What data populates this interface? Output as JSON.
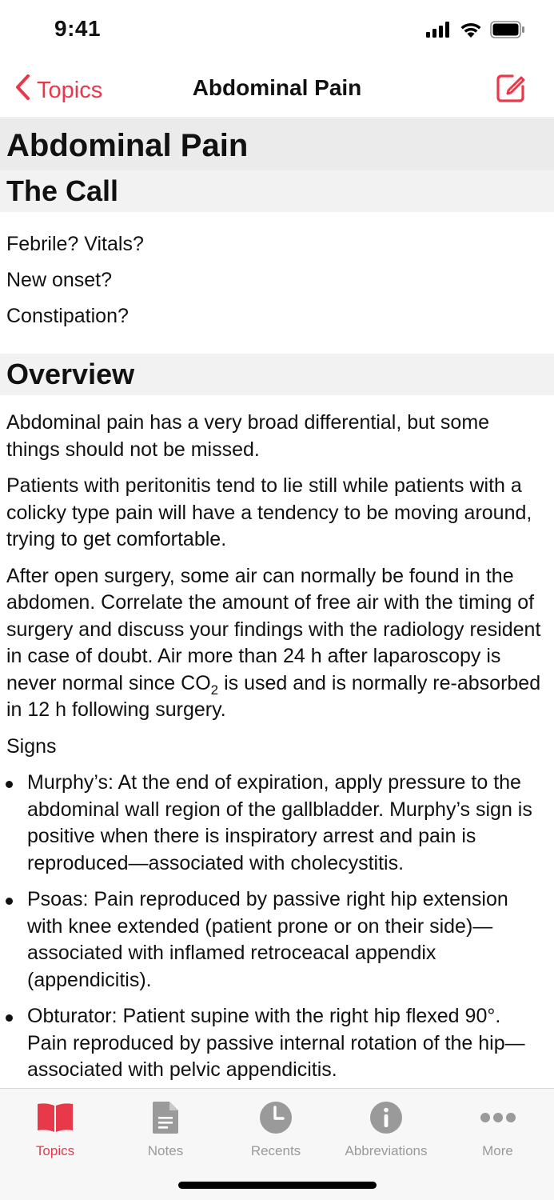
{
  "status_bar": {
    "time": "9:41"
  },
  "nav": {
    "back_label": "Topics",
    "title": "Abdominal Pain"
  },
  "page_title": "Abdominal Pain",
  "the_call": {
    "heading": "The Call",
    "items": [
      "Febrile? Vitals?",
      "New onset?",
      "Constipation?"
    ]
  },
  "overview": {
    "heading": "Overview",
    "p1": "Abdominal pain has a very broad differential, but some things should not be missed.",
    "p2": "Patients with peritonitis tend to lie still while patients with a colicky type pain will have a tendency to be moving around, trying to get comfortable.",
    "p3_before": "After open surgery, some air can normally be found in the abdomen. Correlate the amount of free air with the timing of surgery and discuss your findings with the radiology resident in case of doubt. Air more than 24 h after laparoscopy is never normal since CO",
    "p3_sub": "2",
    "p3_after": " is used and is normally re-absorbed in 12 h following surgery.",
    "signs_label": "Signs",
    "signs": [
      "Murphy’s: At the end of expiration, apply pressure to the abdominal wall region of the gallbladder. Murphy’s sign is positive when there is inspiratory arrest and pain is reproduced—associated with cholecystitis.",
      "Psoas: Pain reproduced by passive right hip extension with knee extended (patient prone or on their side)—associated with inflamed retroceacal appendix (appendicitis).",
      "Obturator: Patient supine with the right hip flexed 90°. Pain reproduced by passive internal rotation of the hip—associated with pelvic appendicitis."
    ]
  },
  "tabs": [
    {
      "label": "Topics",
      "icon": "book-icon",
      "active": true
    },
    {
      "label": "Notes",
      "icon": "document-icon",
      "active": false
    },
    {
      "label": "Recents",
      "icon": "clock-icon",
      "active": false
    },
    {
      "label": "Abbreviations",
      "icon": "info-icon",
      "active": false
    },
    {
      "label": "More",
      "icon": "more-icon",
      "active": false
    }
  ],
  "colors": {
    "accent": "#e8394a",
    "inactive": "#9a9a9a",
    "section_bg": "#f2f2f2"
  }
}
